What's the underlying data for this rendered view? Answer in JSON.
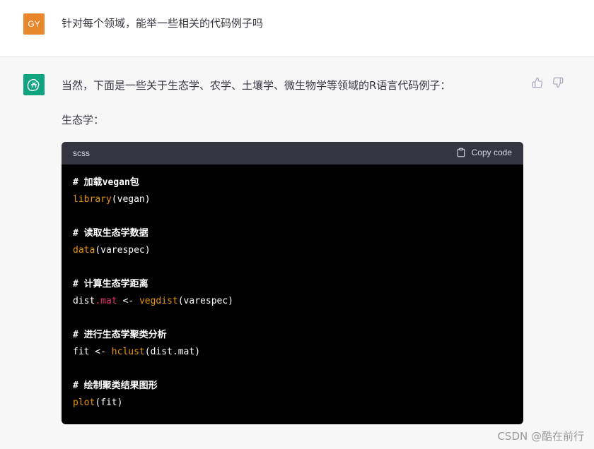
{
  "user": {
    "avatar_text": "GY",
    "message": "针对每个领域，能举一些相关的代码例子吗"
  },
  "assistant": {
    "avatar_icon": "openai-logo-icon",
    "intro": "当然，下面是一些关于生态学、农学、土壤学、微生物学等领域的R语言代码例子：",
    "section_title": "生态学：",
    "feedback": {
      "thumbs_up": "thumbs-up-icon",
      "thumbs_down": "thumbs-down-icon"
    }
  },
  "code": {
    "language": "scss",
    "copy_label": "Copy code",
    "lines": [
      {
        "comment": "# 加载vegan包"
      },
      {
        "func": "library",
        "rest": "(vegan)"
      },
      {
        "blank": true
      },
      {
        "comment": "# 读取生态学数据"
      },
      {
        "func": "data",
        "rest": "(varespec)"
      },
      {
        "blank": true
      },
      {
        "comment": "# 计算生态学距离"
      },
      {
        "pre": "dist",
        "prop": ".mat",
        "mid": " <- ",
        "func": "vegdist",
        "rest": "(varespec)"
      },
      {
        "blank": true
      },
      {
        "comment": "# 进行生态学聚类分析"
      },
      {
        "pre": "fit <- ",
        "func": "hclust",
        "rest": "(dist.mat)"
      },
      {
        "blank": true
      },
      {
        "comment": "# 绘制聚类结果图形"
      },
      {
        "func": "plot",
        "rest": "(fit)"
      }
    ]
  },
  "watermark": "CSDN @酷在前行",
  "colors": {
    "user_avatar": "#e8862b",
    "bot_avatar": "#10a37f",
    "code_bg": "#000000",
    "code_header": "#343541",
    "func": "#e9950c",
    "prop": "#df3079"
  }
}
